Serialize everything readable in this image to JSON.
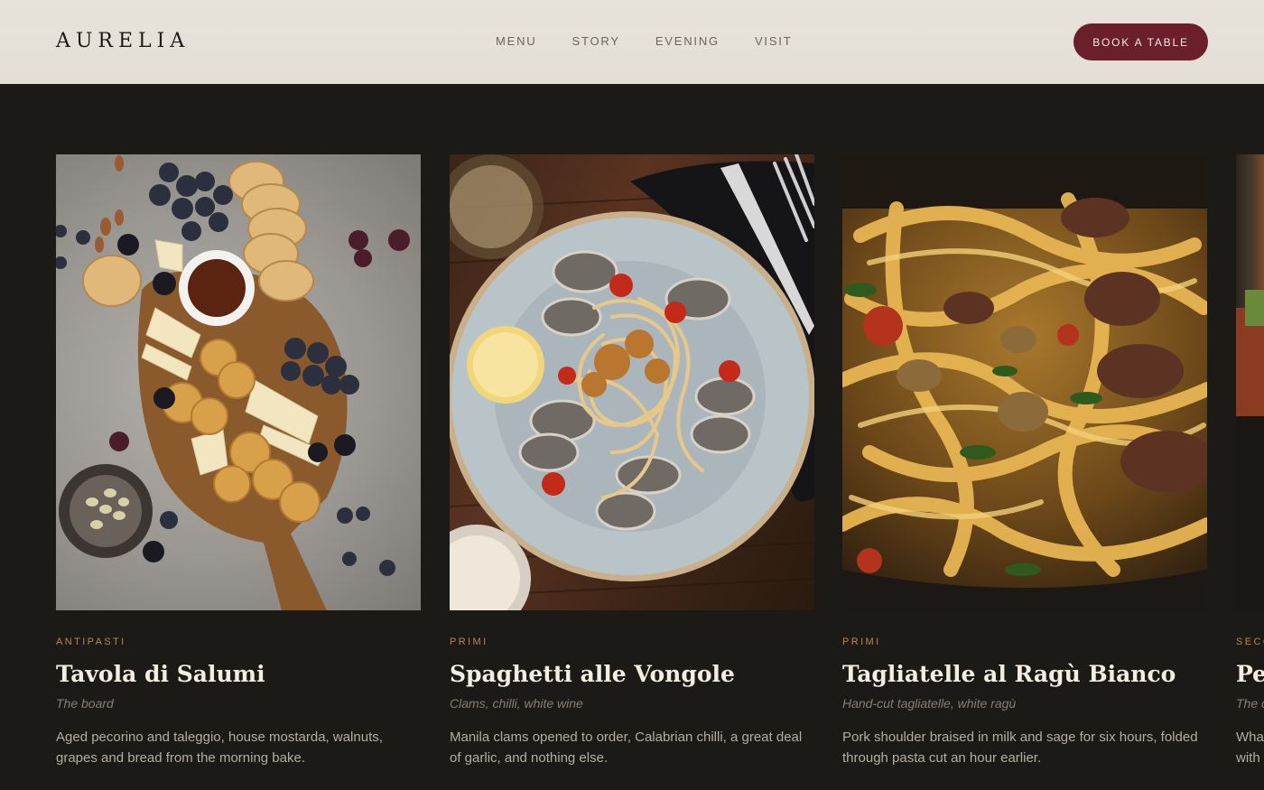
{
  "brand": {
    "name": "AURELIA"
  },
  "nav": {
    "items": [
      "MENU",
      "STORY",
      "EVENING",
      "VISIT"
    ]
  },
  "cta": {
    "label": "BOOK A TABLE"
  },
  "colors": {
    "header_bg": "#e5e1d8",
    "page_bg": "#1c1a17",
    "accent_button": "#6a1f2b",
    "category_text": "#b8874f"
  },
  "dishes": [
    {
      "category": "ANTIPASTI",
      "title": "Tavola di Salumi",
      "subtitle": "The board",
      "description": "Aged pecorino and taleggio, house mostarda, walnuts, grapes and bread from the morning bake.",
      "image": "charcuterie-board"
    },
    {
      "category": "PRIMI",
      "title": "Spaghetti alle Vongole",
      "subtitle": "Clams, chilli, white wine",
      "description": "Manila clams opened to order, Calabrian chilli, a great deal of garlic, and nothing else.",
      "image": "spaghetti-clams"
    },
    {
      "category": "PRIMI",
      "title": "Tagliatelle al Ragù Bianco",
      "subtitle": "Hand-cut tagliatelle, white ragù",
      "description": "Pork shoulder braised in milk and sage for six hours, folded through pasta cut an hour earlier.",
      "image": "tagliatelle-ragu"
    },
    {
      "category": "SECO",
      "title": "Pe",
      "subtitle": "The c",
      "description": "Wha with",
      "image": "salmon-dish-partial"
    }
  ]
}
